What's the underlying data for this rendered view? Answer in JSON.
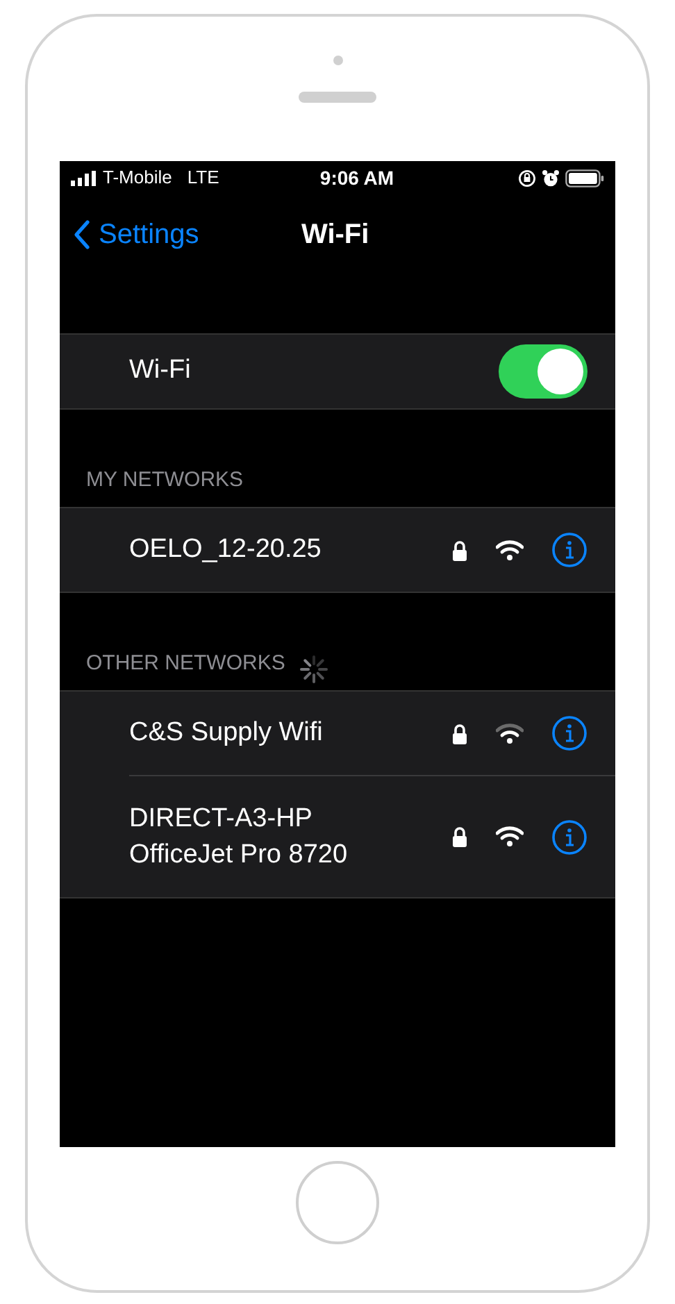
{
  "status_bar": {
    "carrier": "T-Mobile",
    "network": "LTE",
    "time": "9:06 AM"
  },
  "nav": {
    "back": "Settings",
    "title": "Wi-Fi"
  },
  "wifi_toggle": {
    "label": "Wi-Fi",
    "on": true
  },
  "sections": [
    {
      "title": "MY NETWORKS",
      "loading": false,
      "networks": [
        {
          "name": "OELO_12-20.25",
          "locked": true,
          "weak_signal": false
        }
      ]
    },
    {
      "title": "OTHER NETWORKS",
      "loading": true,
      "networks": [
        {
          "name": "C&S Supply Wifi",
          "locked": true,
          "weak_signal": true
        },
        {
          "name": "DIRECT-A3-HP\nOfficeJet Pro 8720",
          "locked": true,
          "weak_signal": false
        }
      ]
    }
  ]
}
